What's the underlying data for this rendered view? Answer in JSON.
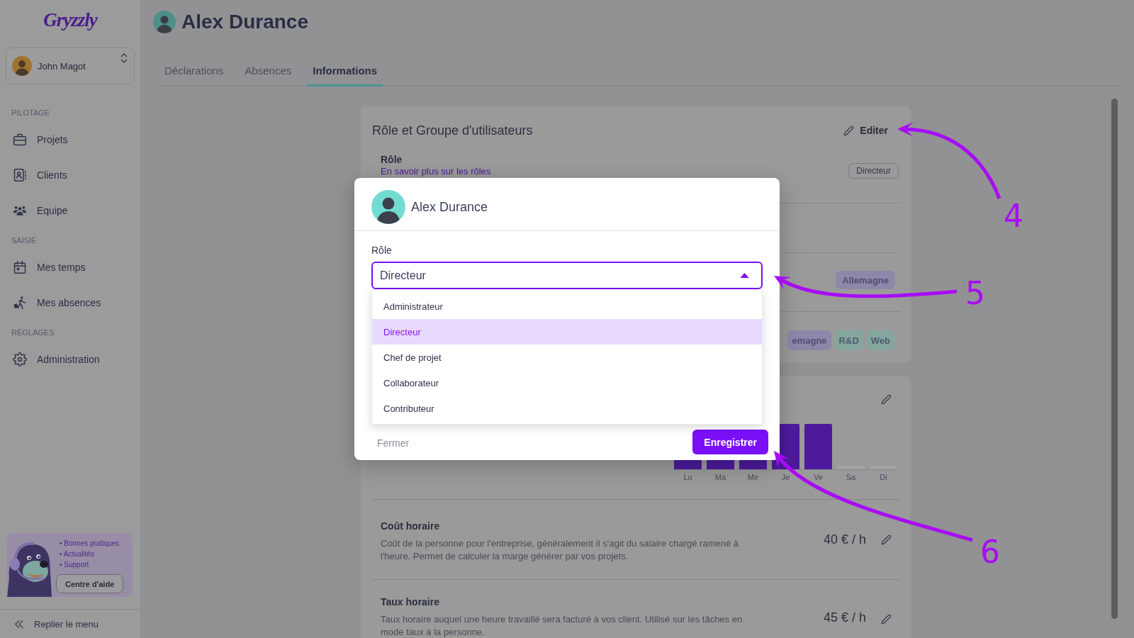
{
  "sidebar": {
    "logo": "Gryzzly",
    "user": {
      "name": "John Magot"
    },
    "sections": [
      {
        "title": "PILOTAGE",
        "items": [
          {
            "label": "Projets"
          },
          {
            "label": "Clients"
          },
          {
            "label": "Equipe"
          }
        ]
      },
      {
        "title": "SAISIE",
        "items": [
          {
            "label": "Mes temps"
          },
          {
            "label": "Mes absences"
          }
        ]
      },
      {
        "title": "RÉGLAGES",
        "items": [
          {
            "label": "Administration"
          }
        ]
      }
    ],
    "help": {
      "links": [
        "• Bonnes pratiques",
        "• Actualités",
        "• Support"
      ],
      "button": "Centre d'aide"
    },
    "collapse": "Replier le menu"
  },
  "header": {
    "name": "Alex Durance"
  },
  "tabs": [
    {
      "label": "Déclarations",
      "selected": false
    },
    {
      "label": "Absences",
      "selected": false
    },
    {
      "label": "Informations",
      "selected": true
    }
  ],
  "role_card": {
    "title": "Rôle et Groupe d'utilisateurs",
    "edit": "Editer",
    "role_label": "Rôle",
    "role_link": "En savoir plus sur les rôles",
    "role_value": "Directeur",
    "tag_rows": [
      {
        "tags": [
          {
            "label": "Allemagne",
            "color": "#8e87a9"
          }
        ]
      },
      {
        "tags": [
          {
            "label": "emagne",
            "color": "#8e87a9"
          },
          {
            "label": "R&D",
            "color": "#85a69e"
          },
          {
            "label": "Web",
            "color": "#85a69e"
          }
        ]
      }
    ]
  },
  "schedule_card": {
    "days": [
      {
        "label": "Lu",
        "kind": "worked"
      },
      {
        "label": "Ma",
        "kind": "worked"
      },
      {
        "label": "Me",
        "kind": "worked"
      },
      {
        "label": "Je",
        "kind": "worked"
      },
      {
        "label": "Ve",
        "kind": "worked"
      },
      {
        "label": "Sa",
        "kind": "off"
      },
      {
        "label": "Di",
        "kind": "off"
      }
    ],
    "rates": [
      {
        "title": "Coût horaire",
        "description": "Coût de la personne pour l'entreprise, généralement il s'agit du salaire chargé ramené à l'heure. Permet de calculer la marge générer par vos projets.",
        "value": "40 € / h"
      },
      {
        "title": "Taux horaire",
        "description": "Taux horaire auquel une heure travaillé sera facturé à vos client. Utilisé sur les tâches en mode taux à la personne.",
        "value": "45 € / h"
      }
    ]
  },
  "modal": {
    "name": "Alex Durance",
    "field_label": "Rôle",
    "value": "Directeur",
    "expanded": true,
    "options": [
      {
        "label": "Administrateur",
        "selected": false
      },
      {
        "label": "Directeur",
        "selected": true
      },
      {
        "label": "Chef de projet",
        "selected": false
      },
      {
        "label": "Collaborateur",
        "selected": false
      },
      {
        "label": "Contributeur",
        "selected": false
      }
    ],
    "cancel": "Fermer",
    "save": "Enregistrer"
  },
  "annotations": [
    {
      "label": "4"
    },
    {
      "label": "5"
    },
    {
      "label": "6"
    }
  ]
}
